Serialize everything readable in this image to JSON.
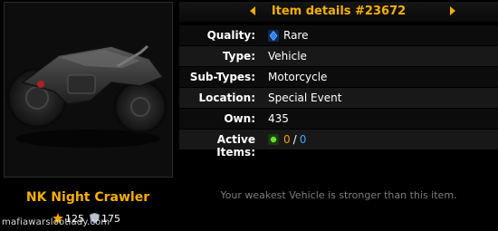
{
  "header": {
    "title": "Item details #23672"
  },
  "item": {
    "name": "NK Night Crawler",
    "attack": "125",
    "defense": "175"
  },
  "details": [
    {
      "label": "Quality:",
      "value": "Rare",
      "icon": "rare-gem-icon"
    },
    {
      "label": "Type:",
      "value": "Vehicle"
    },
    {
      "label": "Sub-Types:",
      "value": "Motorcycle"
    },
    {
      "label": "Location:",
      "value": "Special Event"
    },
    {
      "label": "Own:",
      "value": "435"
    },
    {
      "label": "Active Items:",
      "active": "0",
      "separator": "/",
      "total": "0",
      "icon": "active-indicator-icon"
    }
  ],
  "note": "Your weakest Vehicle is stronger than this item.",
  "watermark": "mafiawarslootlady.com",
  "colors": {
    "accent": "#f4b000",
    "quality_rare": "#2a7fff",
    "active_count": "#f4a000",
    "total_count": "#3fa3ff"
  }
}
